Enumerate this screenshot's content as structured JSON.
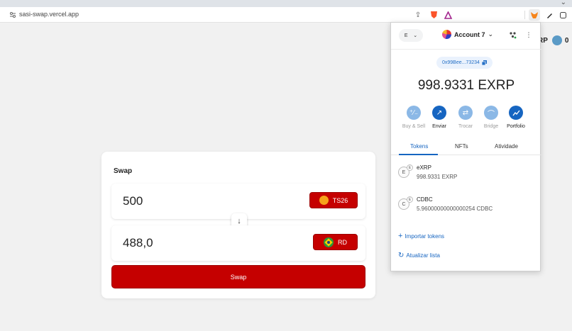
{
  "browser": {
    "url": "sasi-swap.vercel.app"
  },
  "page": {
    "header_text": "RP",
    "header_count": "0"
  },
  "swap": {
    "title": "Swap",
    "from_value": "500",
    "from_token": "TS26",
    "to_value": "488,0",
    "to_token": "RD",
    "submit_label": "Swap",
    "accent_color": "#c50000"
  },
  "metamask": {
    "network_letter": "E",
    "account_name": "Account 7",
    "address": "0x99Bee...73234",
    "balance": "998.9331 EXRP",
    "actions": [
      {
        "label": "Buy & Sell",
        "icon": "plus-minus-icon",
        "enabled": false
      },
      {
        "label": "Enviar",
        "icon": "arrow-up-right-icon",
        "enabled": true
      },
      {
        "label": "Trocar",
        "icon": "swap-arrows-icon",
        "enabled": false
      },
      {
        "label": "Bridge",
        "icon": "bridge-icon",
        "enabled": false
      },
      {
        "label": "Portfolio",
        "icon": "chart-icon",
        "enabled": true
      }
    ],
    "tabs": [
      "Tokens",
      "NFTs",
      "Atividade"
    ],
    "active_tab": "Tokens",
    "tokens": [
      {
        "letter": "E",
        "name": "eXRP",
        "balance": "998.9331 EXRP"
      },
      {
        "letter": "C",
        "name": "CDBC",
        "balance": "5.96000000000000254 CDBC"
      }
    ],
    "import_label": "Importar tokens",
    "refresh_label": "Atualizar lista",
    "accent_color": "#1665c1"
  }
}
